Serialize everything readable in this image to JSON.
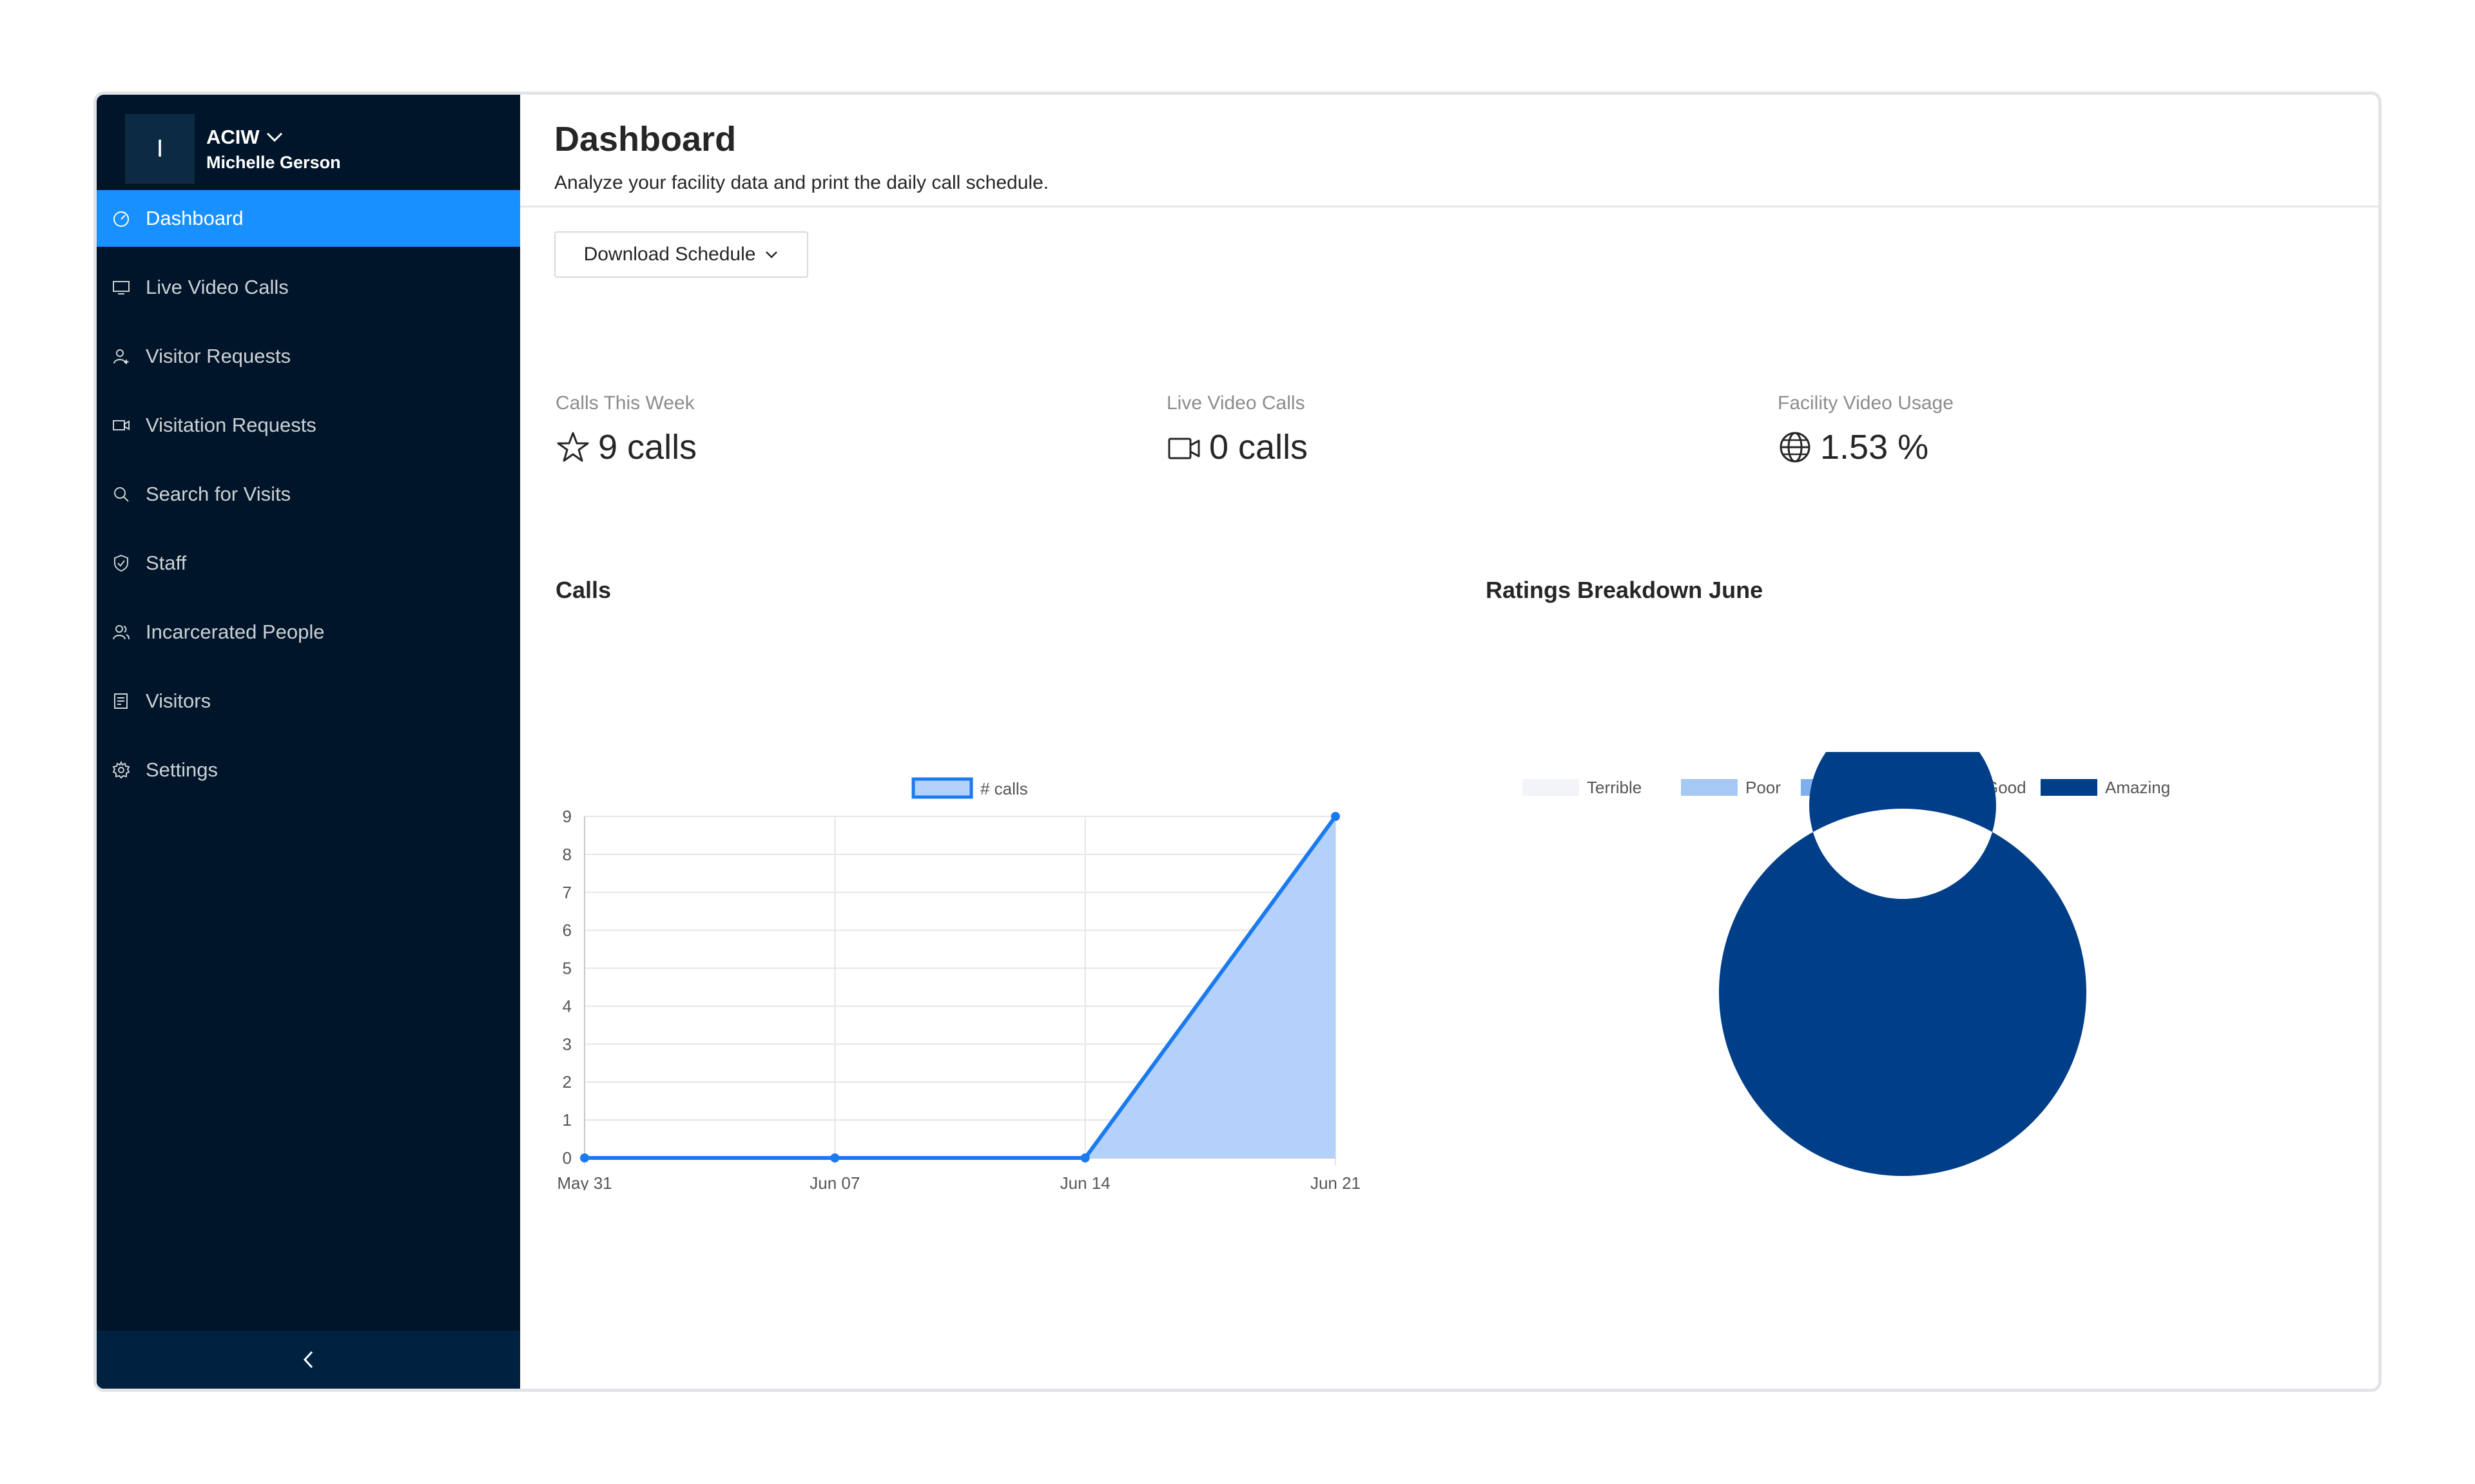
{
  "org": {
    "avatar_letter": "I",
    "name": "ACIW",
    "user": "Michelle Gerson"
  },
  "sidebar": {
    "items": [
      {
        "label": "Dashboard",
        "icon": "dashboard-icon",
        "active": true
      },
      {
        "label": "Live Video Calls",
        "icon": "monitor-icon"
      },
      {
        "label": "Visitor Requests",
        "icon": "user-add-icon"
      },
      {
        "label": "Visitation Requests",
        "icon": "video-camera-icon"
      },
      {
        "label": "Search for Visits",
        "icon": "search-icon"
      },
      {
        "label": "Staff",
        "icon": "safety-icon"
      },
      {
        "label": "Incarcerated People",
        "icon": "team-icon"
      },
      {
        "label": "Visitors",
        "icon": "contacts-icon"
      },
      {
        "label": "Settings",
        "icon": "gear-icon"
      }
    ],
    "collapse_icon": "chevron-left-icon"
  },
  "header": {
    "title": "Dashboard",
    "subtitle": "Analyze your facility data and print the daily call schedule."
  },
  "download_button": {
    "label": "Download Schedule",
    "icon": "chevron-down-icon"
  },
  "stats": [
    {
      "label": "Calls This Week",
      "value": "9 calls",
      "icon": "star-icon"
    },
    {
      "label": "Live Video Calls",
      "value": "0 calls",
      "icon": "video-camera-icon"
    },
    {
      "label": "Facility Video Usage",
      "value": "1.53 %",
      "icon": "globe-icon"
    }
  ],
  "calls_chart_title": "Calls",
  "ratings_chart_title": "Ratings Breakdown June",
  "colors": {
    "sidebar_bg": "#001529",
    "accent": "#1890ff",
    "line": "#1a7af0",
    "area": "#b3d1fb"
  },
  "chart_data": [
    {
      "type": "area",
      "x": [
        "May 31",
        "Jun 07",
        "Jun 14",
        "Jun 21"
      ],
      "series": [
        {
          "name": "# calls",
          "values": [
            0,
            0,
            0,
            9
          ]
        }
      ],
      "ylim": [
        0,
        9
      ],
      "yticks": [
        0,
        1,
        2,
        3,
        4,
        5,
        6,
        7,
        8,
        9
      ],
      "grid": true,
      "legend": "top"
    },
    {
      "type": "pie",
      "donut": true,
      "categories": [
        "Terrible",
        "Poor",
        "Okay",
        "Good",
        "Amazing"
      ],
      "values": [
        0,
        0,
        0,
        0,
        100
      ],
      "colors": [
        "#f2f4f8",
        "#a6c8f5",
        "#7fb0ee",
        "#0e6fd9",
        "#003f88"
      ],
      "legend": "top"
    }
  ]
}
